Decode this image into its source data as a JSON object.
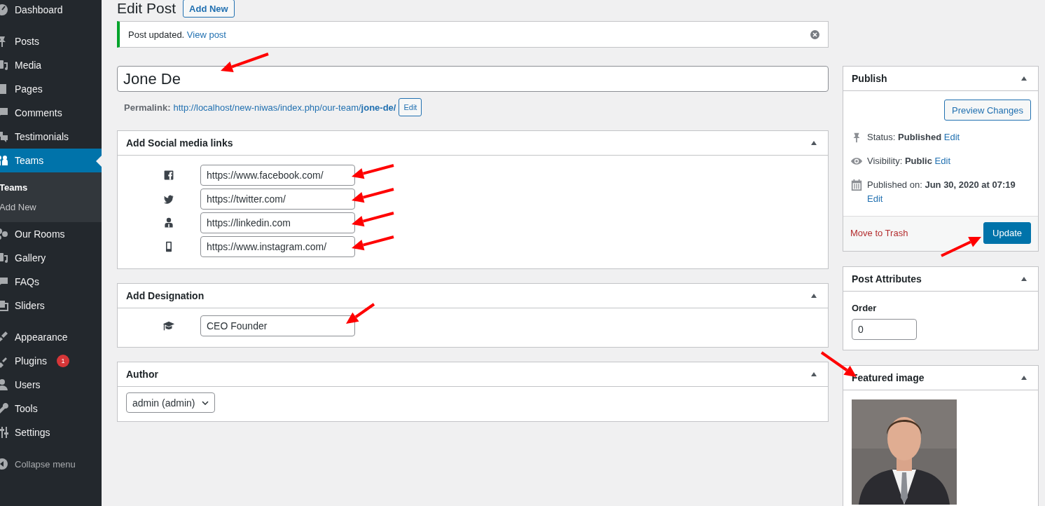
{
  "admin_menu": {
    "groups": [
      [
        {
          "kind": "dashboard",
          "label": "Dashboard",
          "selected": false
        }
      ],
      [
        {
          "kind": "pin",
          "label": "Posts",
          "selected": false
        },
        {
          "kind": "media",
          "label": "Media",
          "selected": false
        },
        {
          "kind": "pages",
          "label": "Pages",
          "selected": false
        },
        {
          "kind": "comments",
          "label": "Comments",
          "selected": false
        },
        {
          "kind": "testimonials",
          "label": "Testimonials",
          "selected": false
        },
        {
          "kind": "teams",
          "label": "Teams",
          "selected": true,
          "submenu": [
            {
              "label": "Teams",
              "selected": true
            },
            {
              "label": "Add New",
              "selected": false
            }
          ]
        },
        {
          "kind": "rooms",
          "label": "Our Rooms",
          "selected": false
        },
        {
          "kind": "media",
          "label": "Gallery",
          "selected": false
        },
        {
          "kind": "faq",
          "label": "FAQs",
          "selected": false
        },
        {
          "kind": "sliders",
          "label": "Sliders",
          "selected": false
        }
      ],
      [
        {
          "kind": "appearance",
          "label": "Appearance",
          "selected": false
        },
        {
          "kind": "plugins",
          "label": "Plugins",
          "selected": false,
          "badge": "1"
        },
        {
          "kind": "users",
          "label": "Users",
          "selected": false
        },
        {
          "kind": "tools",
          "label": "Tools",
          "selected": false
        },
        {
          "kind": "settings",
          "label": "Settings",
          "selected": false
        }
      ]
    ],
    "collapse": {
      "label": "Collapse menu"
    }
  },
  "heading": {
    "title": "Edit Post",
    "add_new": "Add New"
  },
  "notice": {
    "text": "Post updated.",
    "link": "View post"
  },
  "title_field": {
    "value": "Jone De",
    "arrow": true
  },
  "permalink": {
    "label": "Permalink:",
    "url": "http://localhost/new-niwas/index.php/our-team/**jone-de/**",
    "button": "Edit"
  },
  "social_box": {
    "title": "Add Social media links",
    "links": [
      {
        "kind": "facebook",
        "value": "https://www.facebook.com/",
        "arrow": true
      },
      {
        "kind": "twitter",
        "value": "https://twitter.com/",
        "arrow": true
      },
      {
        "kind": "person",
        "value": "https://linkedin.com",
        "arrow": true
      },
      {
        "kind": "phone",
        "value": "https://www.instagram.com/",
        "arrow": true
      }
    ]
  },
  "designation_box": {
    "title": "Add Designation",
    "value": "CEO Founder",
    "arrow": true
  },
  "author_box": {
    "title": "Author",
    "value": "admin (admin)"
  },
  "publish_box": {
    "title": "Publish",
    "preview_button": "Preview Changes",
    "rows": [
      {
        "kind": "pin",
        "text": "Status: **Published**",
        "link": "Edit"
      },
      {
        "kind": "eye",
        "text": "Visibility: **Public**",
        "link": "Edit"
      },
      {
        "kind": "calendar",
        "text": "Published on: **Jun 30, 2020 at 07:19**",
        "link": "Edit"
      }
    ],
    "trash_link": "Move to Trash",
    "update_button": "Update",
    "arrow": true
  },
  "attributes_box": {
    "title": "Post Attributes",
    "order_label": "Order",
    "order_value": "0"
  },
  "featured_box": {
    "title": "Featured image",
    "arrow": true
  }
}
